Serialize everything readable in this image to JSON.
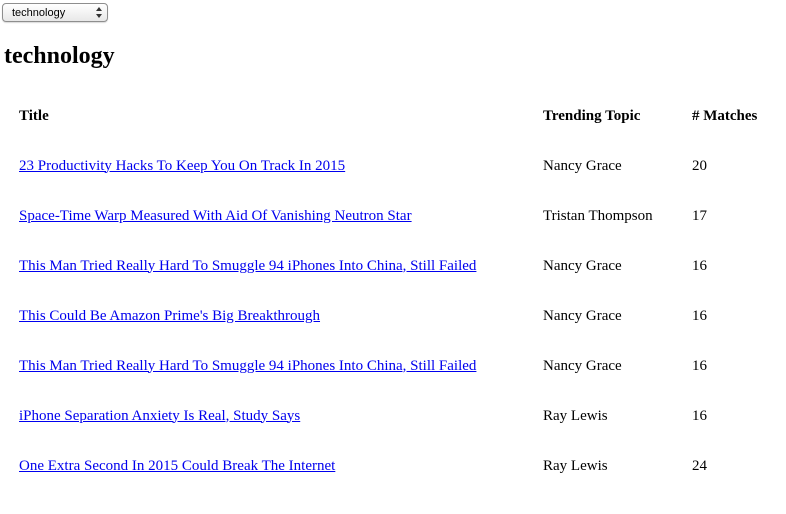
{
  "category_select": {
    "selected": "technology"
  },
  "page_title": "technology",
  "table": {
    "headers": {
      "title": "Title",
      "topic": "Trending Topic",
      "matches": "# Matches"
    },
    "rows": [
      {
        "title": "23 Productivity Hacks To Keep You On Track In 2015",
        "topic": "Nancy Grace",
        "matches": "20"
      },
      {
        "title": "Space-Time Warp Measured With Aid Of Vanishing Neutron Star",
        "topic": "Tristan Thompson",
        "matches": "17"
      },
      {
        "title": "This Man Tried Really Hard To Smuggle 94 iPhones Into China, Still Failed",
        "topic": "Nancy Grace",
        "matches": "16"
      },
      {
        "title": "This Could Be Amazon Prime's Big Breakthrough",
        "topic": "Nancy Grace",
        "matches": "16"
      },
      {
        "title": "This Man Tried Really Hard To Smuggle 94 iPhones Into China, Still Failed",
        "topic": "Nancy Grace",
        "matches": "16"
      },
      {
        "title": "iPhone Separation Anxiety Is Real, Study Says",
        "topic": "Ray Lewis",
        "matches": "16"
      },
      {
        "title": "One Extra Second In 2015 Could Break The Internet",
        "topic": "Ray Lewis",
        "matches": "24"
      }
    ]
  },
  "colors": {
    "link": "#0000ee",
    "text": "#000000",
    "background": "#ffffff"
  }
}
